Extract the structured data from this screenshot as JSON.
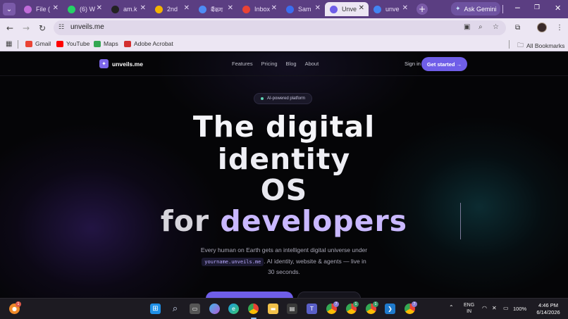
{
  "browser": {
    "tabs": [
      {
        "title": "File (",
        "favicon": "file-icon",
        "color": "#c06bd8",
        "active": false
      },
      {
        "title": "(6) W",
        "favicon": "whatsapp-icon",
        "color": "#25d366",
        "active": false
      },
      {
        "title": "am.k",
        "favicon": "github-icon",
        "color": "#222222",
        "active": false
      },
      {
        "title": "2nd",
        "favicon": "drive-icon",
        "color": "#f4b400",
        "active": false
      },
      {
        "title": "बैंकग",
        "favicon": "gemini-tab-icon",
        "color": "#4e8cf5",
        "active": false
      },
      {
        "title": "Inbox",
        "favicon": "gmail-icon",
        "color": "#ea4335",
        "active": false
      },
      {
        "title": "Sam",
        "favicon": "un-icon",
        "color": "#3b6ef0",
        "active": false
      },
      {
        "title": "Unve",
        "favicon": "unveils-icon",
        "color": "#6f5ee8",
        "active": true
      },
      {
        "title": "unve",
        "favicon": "google-icon",
        "color": "#4285f4",
        "active": false
      }
    ],
    "ask_gemini": "Ask Gemini",
    "window_controls": {
      "minimize": "─",
      "maximize": "❐",
      "close": "✕"
    },
    "url": "unveils.me",
    "bookmarks": [
      {
        "label": "Gmail",
        "color": "#ea4335"
      },
      {
        "label": "YouTube",
        "color": "#ff0000"
      },
      {
        "label": "Maps",
        "color": "#34a853"
      },
      {
        "label": "Adobe Acrobat",
        "color": "#d32f2f"
      }
    ],
    "all_bookmarks": "All Bookmarks"
  },
  "site": {
    "logo_text": "unveils.me",
    "nav": [
      "Features",
      "Pricing",
      "Blog",
      "About"
    ],
    "sign_in": "Sign in",
    "get_started": "Get started →",
    "badge": "AI-powered platform",
    "hero_line1": "The digital",
    "hero_line2": "identity",
    "hero_line3": "OS",
    "hero_line4_a": "for ",
    "hero_line4_b": "developers",
    "sub_line1": "Every human on Earth gets an intelligent digital universe under",
    "sub_code": "yourname.unveils.me",
    "sub_line2": ". AI identity, website & agents — live in",
    "sub_line3": "30 seconds."
  },
  "taskbar": {
    "notification_count": "1",
    "badges": [
      "7",
      "1",
      "1",
      "7"
    ],
    "lang_top": "ENG",
    "lang_bottom": "IN",
    "battery": "100%",
    "time": "4:46 PM",
    "date": "6/14/2026"
  }
}
